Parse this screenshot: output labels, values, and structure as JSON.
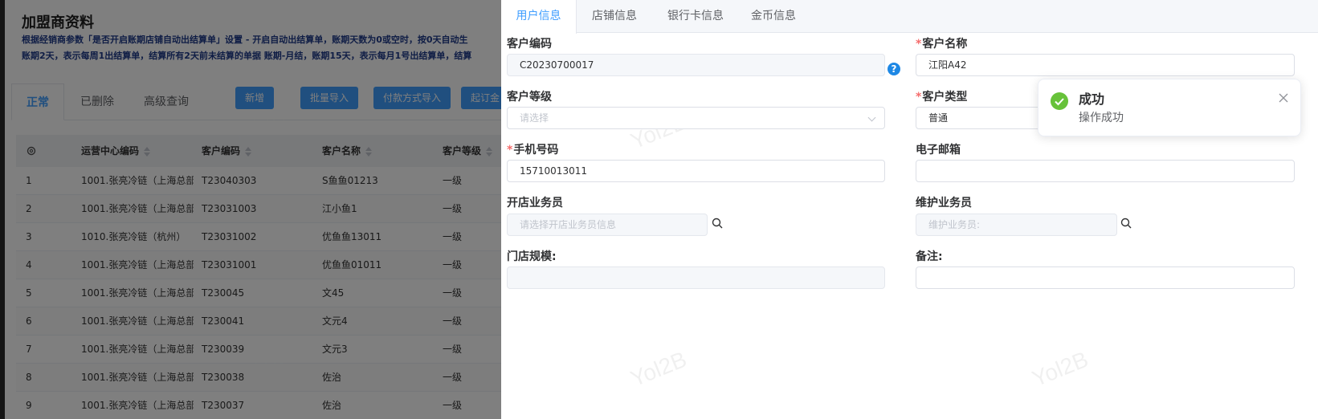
{
  "background": {
    "title": "加盟商资料",
    "description_lines": [
      "根据经销商参数「是否开启账期店铺自动出结算单」设置 - 开启自动出结算单，账期天数为0或空时，按0天自动生",
      "账期2天，表示每周1出结算单，结算所有2天前未结算的单据 账期-月结，账期15天，表示每月1号出结算单，结算"
    ],
    "tabs": [
      "正常",
      "已删除",
      "高级查询"
    ],
    "buttons": [
      "新增",
      "批量导入",
      "付款方式导入",
      "起订金"
    ],
    "table": {
      "headers": [
        "运营中心编码",
        "客户编码",
        "客户名称",
        "客户等级"
      ],
      "rows": [
        [
          "1",
          "1001.张亮冷链（上海总部",
          "T23040303",
          "S鱼鱼01213",
          "一级"
        ],
        [
          "2",
          "1001.张亮冷链（上海总部",
          "T23031003",
          "江小鱼1",
          "一级"
        ],
        [
          "3",
          "1010.张亮冷链（杭州）",
          "T23031002",
          "优鱼鱼13011",
          "一级"
        ],
        [
          "4",
          "1001.张亮冷链（上海总部",
          "T23031001",
          "优鱼鱼01011",
          "一级"
        ],
        [
          "5",
          "1001.张亮冷链（上海总部",
          "T230045",
          "文45",
          "一级"
        ],
        [
          "6",
          "1001.张亮冷链（上海总部",
          "T230041",
          "文元4",
          "一级"
        ],
        [
          "7",
          "1001.张亮冷链（上海总部",
          "T230039",
          "文元3",
          "一级"
        ],
        [
          "8",
          "1001.张亮冷链（上海总部",
          "T230038",
          "佐治",
          "一级"
        ],
        [
          "9",
          "1001.张亮冷链（上海总部",
          "T230037",
          "佐治",
          "一级"
        ]
      ]
    },
    "watermark": "Yol2B"
  },
  "drawer": {
    "tabs": [
      "用户信息",
      "店铺信息",
      "银行卡信息",
      "金币信息"
    ],
    "form": {
      "customer_code": {
        "label": "客户编码",
        "value": "C20230700017"
      },
      "customer_name": {
        "label": "客户名称",
        "value": "江阳A42"
      },
      "customer_level": {
        "label": "客户等级",
        "placeholder": "请选择"
      },
      "customer_type": {
        "label": "客户类型",
        "value": "普通"
      },
      "phone": {
        "label": "手机号码",
        "value": "15710013011"
      },
      "email": {
        "label": "电子邮箱",
        "value": ""
      },
      "opening_salesman": {
        "label": "开店业务员",
        "placeholder": "请选择开店业务员信息"
      },
      "maintenance_salesman": {
        "label": "维护业务员",
        "placeholder": "维护业务员:"
      },
      "store_scale": {
        "label": "门店规模:",
        "value": ""
      },
      "remark": {
        "label": "备注:",
        "value": ""
      }
    },
    "watermark": "Yol2B"
  },
  "toast": {
    "title": "成功",
    "message": "操作成功"
  },
  "colors": {
    "primary": "#409eff",
    "success": "#67c23a",
    "required": "#f56c6c",
    "help": "#1e88e5"
  }
}
